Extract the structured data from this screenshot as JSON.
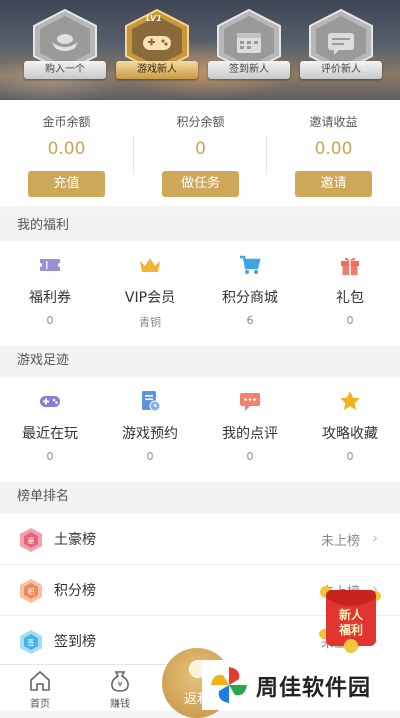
{
  "header": {
    "badges": [
      {
        "label": "购入一个",
        "icon": "ingot-icon",
        "active": false
      },
      {
        "label": "游戏新人",
        "icon": "gamepad-icon",
        "active": true,
        "level": "LV1"
      },
      {
        "label": "签到新人",
        "icon": "calendar-icon",
        "active": false
      },
      {
        "label": "评价新人",
        "icon": "comment-icon",
        "active": false
      }
    ]
  },
  "balance": {
    "items": [
      {
        "label": "金币余额",
        "value": "0.00",
        "button": "充值"
      },
      {
        "label": "积分余额",
        "value": "0",
        "button": "做任务"
      },
      {
        "label": "邀请收益",
        "value": "0.00",
        "button": "邀请"
      }
    ],
    "accent_color": "#cfa75a"
  },
  "welfare": {
    "title": "我的福利",
    "items": [
      {
        "name": "福利券",
        "count": "0",
        "icon": "ticket-icon"
      },
      {
        "name": "VIP会员",
        "count": "青铜",
        "icon": "crown-icon"
      },
      {
        "name": "积分商城",
        "count": "6",
        "icon": "cart-icon"
      },
      {
        "name": "礼包",
        "count": "0",
        "icon": "gift-icon"
      }
    ]
  },
  "footprint": {
    "title": "游戏足迹",
    "items": [
      {
        "name": "最近在玩",
        "count": "0",
        "icon": "gamepad-icon"
      },
      {
        "name": "游戏预约",
        "count": "0",
        "icon": "reservation-icon"
      },
      {
        "name": "我的点评",
        "count": "0",
        "icon": "comment-icon"
      },
      {
        "name": "攻略收藏",
        "count": "0",
        "icon": "star-icon"
      }
    ]
  },
  "ranking": {
    "title": "榜单排名",
    "items": [
      {
        "name": "土豪榜",
        "status": "未上榜",
        "icon": "rich-rank-icon"
      },
      {
        "name": "积分榜",
        "status": "未上榜",
        "icon": "points-rank-icon"
      },
      {
        "name": "签到榜",
        "status": "未上榜",
        "icon": "checkin-rank-icon"
      }
    ]
  },
  "floating_packet": {
    "line1": "新人",
    "line2": "福利"
  },
  "bottom_nav": {
    "items": [
      {
        "label": "首页",
        "icon": "home-icon"
      },
      {
        "label": "赚钱",
        "icon": "money-bag-icon"
      }
    ],
    "center_label": "返利"
  },
  "watermark": {
    "text": "周佳软件园"
  }
}
